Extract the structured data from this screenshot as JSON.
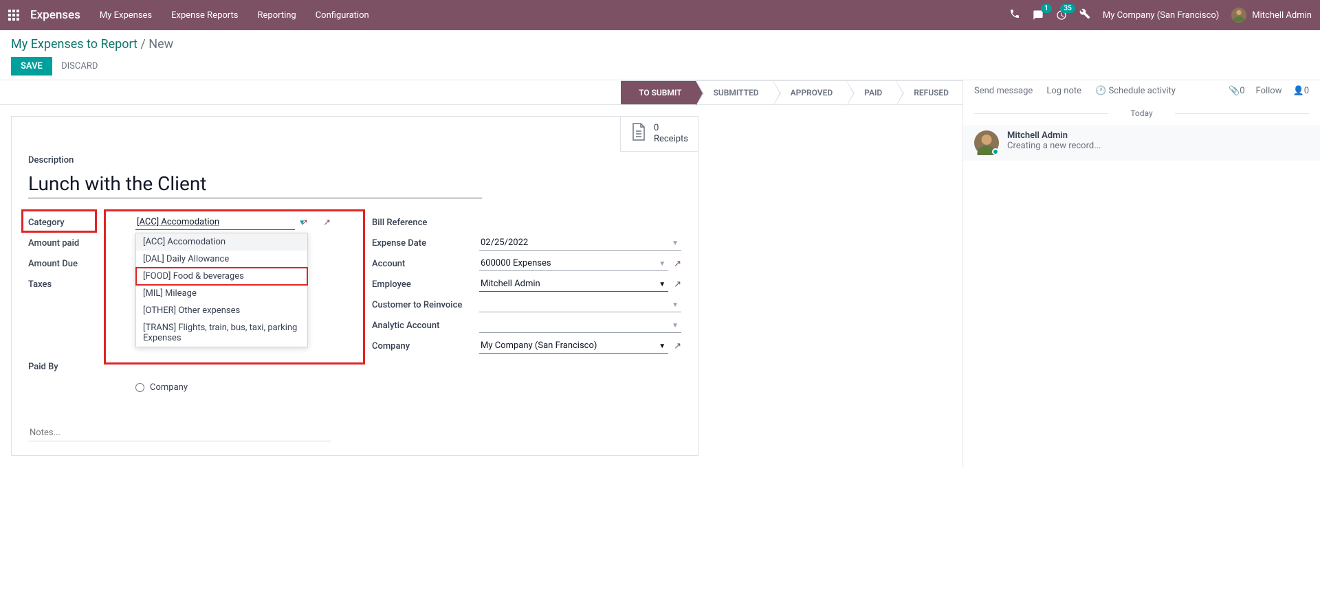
{
  "topnav": {
    "brand": "Expenses",
    "menu": [
      "My Expenses",
      "Expense Reports",
      "Reporting",
      "Configuration"
    ],
    "messages_badge": "1",
    "activities_badge": "35",
    "company": "My Company (San Francisco)",
    "user": "Mitchell Admin"
  },
  "breadcrumb": {
    "parent": "My Expenses to Report",
    "sep": "/",
    "current": "New"
  },
  "actions": {
    "save": "SAVE",
    "discard": "DISCARD"
  },
  "statusbar": [
    "TO SUBMIT",
    "SUBMITTED",
    "APPROVED",
    "PAID",
    "REFUSED"
  ],
  "receipts": {
    "count": "0",
    "label": "Receipts"
  },
  "form": {
    "description_label": "Description",
    "description_value": "Lunch with the Client",
    "labels": {
      "category": "Category",
      "amount_paid": "Amount paid",
      "amount_due": "Amount Due",
      "taxes": "Taxes",
      "paid_by": "Paid By",
      "company_radio": "Company",
      "bill_reference": "Bill Reference",
      "expense_date": "Expense Date",
      "account": "Account",
      "employee": "Employee",
      "customer": "Customer to Reinvoice",
      "analytic": "Analytic Account",
      "company": "Company"
    },
    "values": {
      "category": "[ACC] Accomodation",
      "expense_date": "02/25/2022",
      "account": "600000 Expenses",
      "employee": "Mitchell Admin",
      "company": "My Company (San Francisco)"
    },
    "category_options": [
      "[ACC] Accomodation",
      "[DAL] Daily Allowance",
      "[FOOD] Food & beverages",
      "[MIL] Mileage",
      "[OTHER] Other expenses",
      "[TRANS] Flights, train, bus, taxi, parking Expenses"
    ],
    "notes_placeholder": "Notes..."
  },
  "chatter": {
    "send_message": "Send message",
    "log_note": "Log note",
    "schedule": "Schedule activity",
    "attach_count": "0",
    "follow": "Follow",
    "followers_count": "0",
    "today": "Today",
    "msg_author": "Mitchell Admin",
    "msg_body": "Creating a new record..."
  }
}
